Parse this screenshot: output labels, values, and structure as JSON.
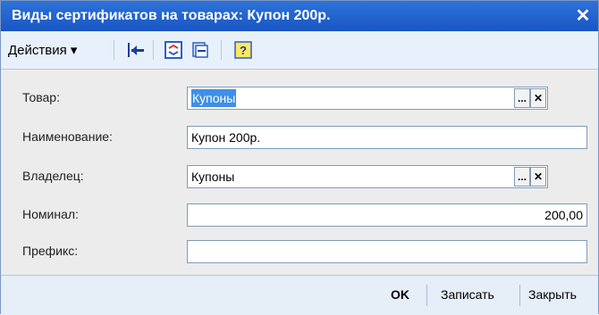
{
  "window": {
    "title": "Виды сертификатов на товарах: Купон 200р."
  },
  "toolbar": {
    "actions_label": "Действия"
  },
  "form": {
    "tovar": {
      "label": "Товар:",
      "value": "Купоны"
    },
    "name": {
      "label": "Наименование:",
      "value": "Купон 200р."
    },
    "owner": {
      "label": "Владелец:",
      "value": "Купоны"
    },
    "nominal": {
      "label": "Номинал:",
      "value": "200,00"
    },
    "prefix": {
      "label": "Префикс:",
      "value": ""
    }
  },
  "footer": {
    "ok": "OK",
    "save": "Записать",
    "close": "Закрыть"
  }
}
